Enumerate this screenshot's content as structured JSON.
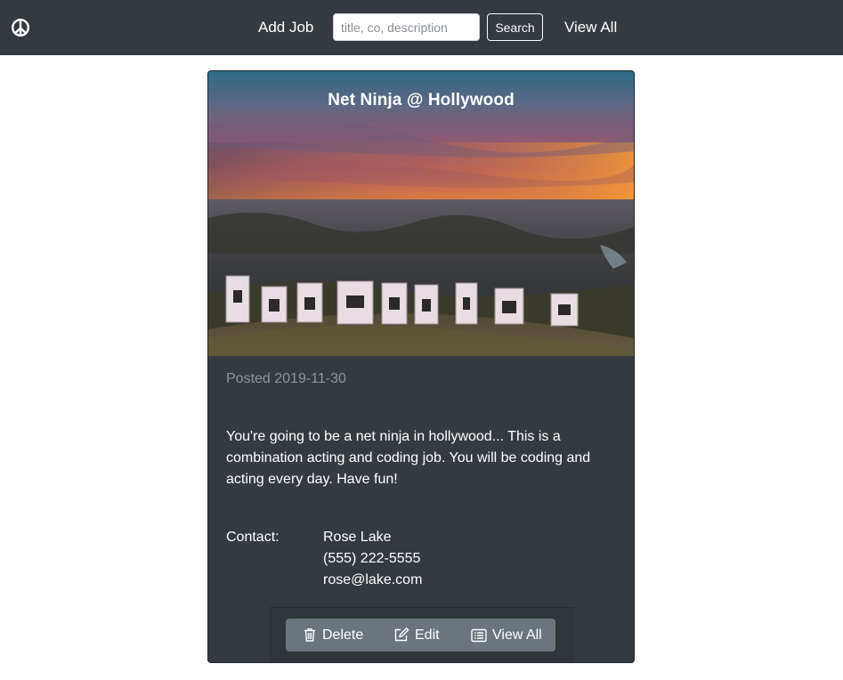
{
  "navbar": {
    "brand_icon": "peace-icon",
    "add_job_label": "Add Job",
    "search_placeholder": "title, co, description",
    "search_value": "",
    "search_button_label": "Search",
    "view_all_label": "View All",
    "background": "#343a40"
  },
  "job": {
    "title": "Net Ninja @ Hollywood",
    "posted": "Posted 2019-11-30",
    "description": "You're going to be a net ninja in hollywood... This is a combination acting and coding job. You will be coding and acting every day. Have fun!",
    "contact_label": "Contact:",
    "contact_name": "Rose Lake",
    "contact_phone": "(555) 222-5555",
    "contact_email": "rose@lake.com",
    "hero_image": "hollywood-sign-sunset"
  },
  "actions": {
    "delete_label": "Delete",
    "edit_label": "Edit",
    "view_all_label": "View All",
    "delete_icon": "trash-icon",
    "edit_icon": "edit-icon",
    "view_all_icon": "list-icon"
  },
  "colors": {
    "card_bg": "#343a40",
    "button_group_bg": "#6c757d",
    "muted_text": "#8f959b"
  }
}
